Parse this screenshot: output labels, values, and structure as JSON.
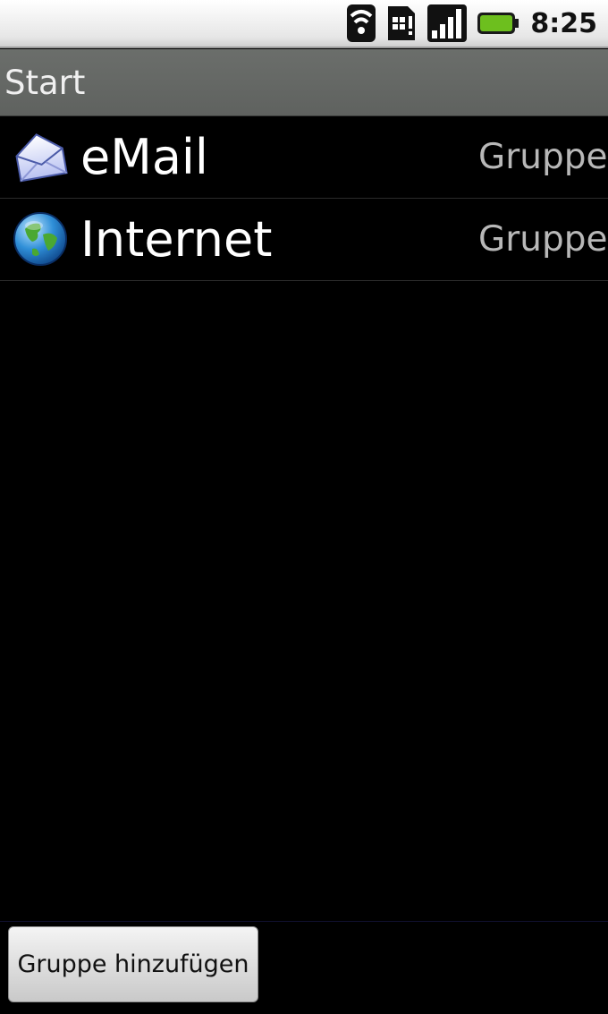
{
  "status_bar": {
    "time": "8:25",
    "icons": [
      "wifi-icon",
      "sim-icon",
      "signal-icon",
      "battery-icon"
    ],
    "battery_color": "#6dbf1e"
  },
  "title_bar": {
    "title": "Start"
  },
  "list": {
    "items": [
      {
        "label": "eMail",
        "group": "Gruppe",
        "icon": "email-envelope-icon"
      },
      {
        "label": "Internet",
        "group": "Gruppe",
        "icon": "globe-icon"
      }
    ]
  },
  "footer": {
    "add_group_label": "Gruppe hinzufügen"
  }
}
